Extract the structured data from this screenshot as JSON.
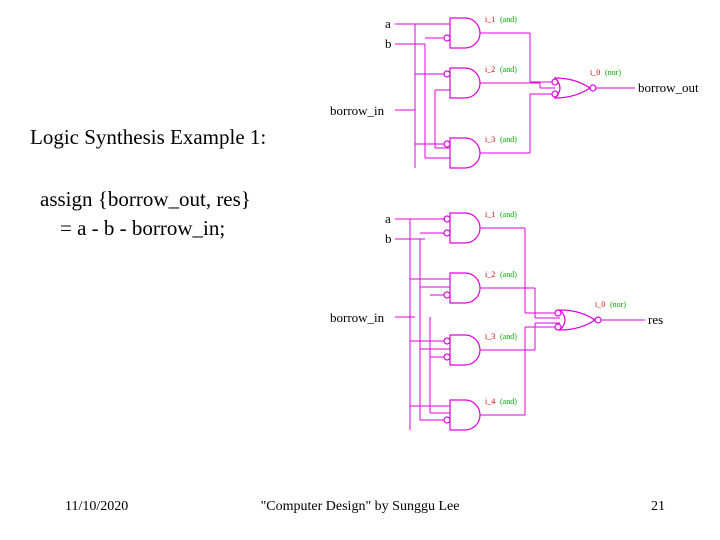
{
  "title": "Logic Synthesis Example 1:",
  "code_line1": "assign {borrow_out, res}",
  "code_line2": "= a - b - borrow_in;",
  "footer": {
    "date": "11/10/2020",
    "center": "\"Computer Design\" by Sunggu Lee",
    "page": "21"
  },
  "circuit": {
    "top_block": {
      "inputs": [
        "a",
        "b",
        "borrow_in"
      ],
      "gates": [
        {
          "id": "i_1",
          "type": "and",
          "label": "(and)"
        },
        {
          "id": "i_2",
          "type": "and",
          "label": "(and)"
        },
        {
          "id": "i_3",
          "type": "and",
          "label": "(and)"
        }
      ],
      "output_gate": {
        "id": "i_0",
        "type": "nor",
        "label": "(nor)"
      },
      "output": "borrow_out"
    },
    "bottom_block": {
      "inputs": [
        "a",
        "b",
        "borrow_in"
      ],
      "gates": [
        {
          "id": "i_1",
          "type": "and",
          "label": "(and)"
        },
        {
          "id": "i_2",
          "type": "and",
          "label": "(and)"
        },
        {
          "id": "i_3",
          "type": "and",
          "label": "(and)"
        },
        {
          "id": "i_4",
          "type": "and",
          "label": "(and)"
        }
      ],
      "output_gate": {
        "id": "i_0",
        "type": "nor",
        "label": "(nor)"
      },
      "output": "res"
    }
  }
}
